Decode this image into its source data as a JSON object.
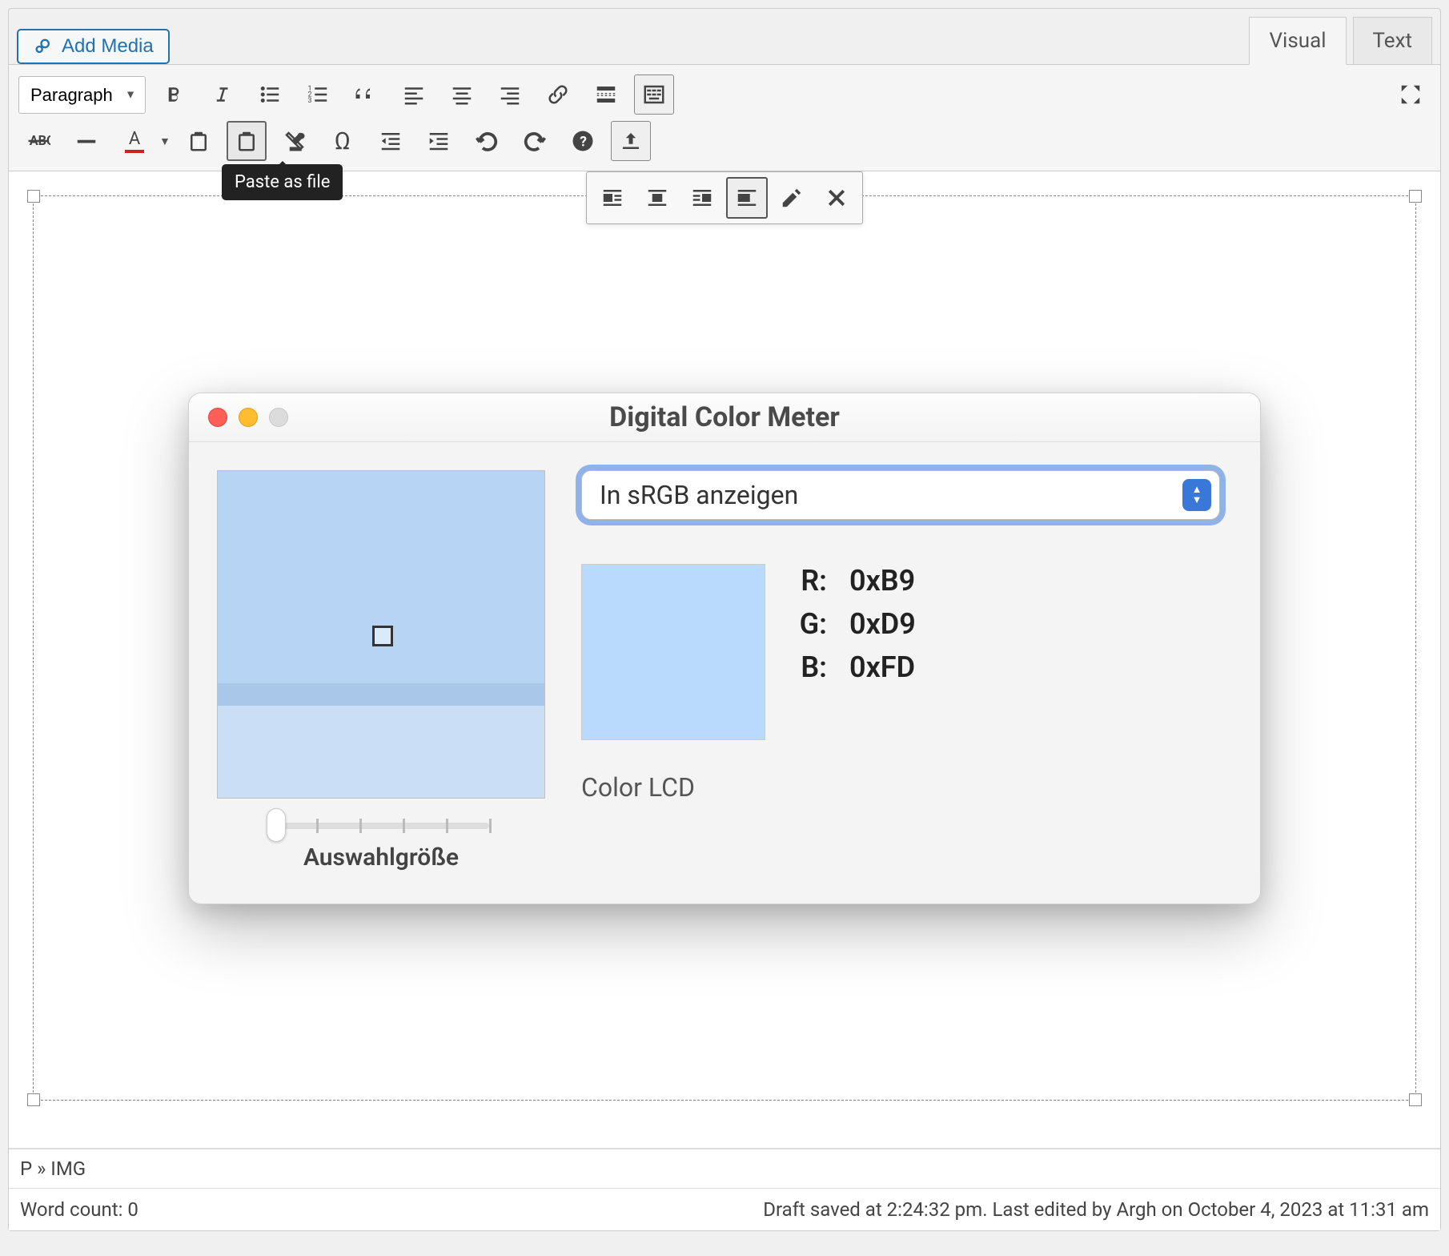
{
  "addMediaLabel": "Add Media",
  "tabs": {
    "visual": "Visual",
    "text": "Text"
  },
  "formatSelect": "Paragraph",
  "tooltip": "Paste as file",
  "macWindow": {
    "title": "Digital Color Meter",
    "dropdownValue": "In sRGB anzeigen",
    "rgb": {
      "rLabel": "R:",
      "rValue": "0xB9",
      "gLabel": "G:",
      "gValue": "0xD9",
      "bLabel": "B:",
      "bValue": "0xFD"
    },
    "displayName": "Color LCD",
    "sliderLabel": "Auswahlgröße"
  },
  "pathBar": "P » IMG",
  "statusBar": {
    "wordCountLabel": "Word count: ",
    "wordCount": "0",
    "saveStatus": "Draft saved at 2:24:32 pm. Last edited by Argh on October 4, 2023 at 11:31 am"
  }
}
